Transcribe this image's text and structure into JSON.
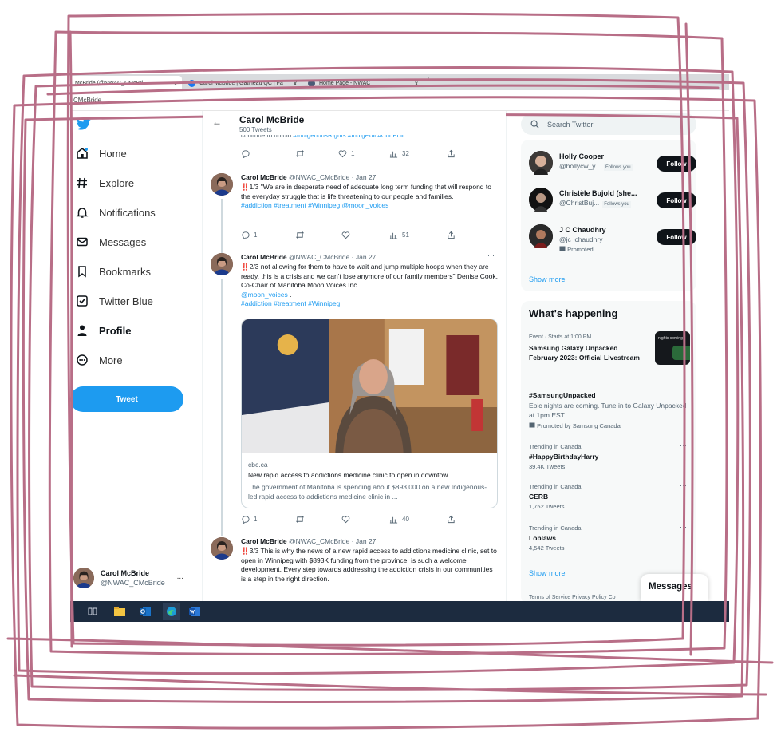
{
  "browser": {
    "tabs": [
      {
        "label": "McBride (@NWAC_CMcBri"
      },
      {
        "label": "Carol McBride | Gatineau QC | Fa"
      },
      {
        "label": "Home Page - NWAC"
      }
    ],
    "tab_close": "x",
    "new_tab": "+",
    "url": "CMcBride"
  },
  "sidebar": {
    "items": [
      {
        "label": "Home",
        "icon": "home-icon"
      },
      {
        "label": "Explore",
        "icon": "hashtag-icon"
      },
      {
        "label": "Notifications",
        "icon": "bell-icon"
      },
      {
        "label": "Messages",
        "icon": "envelope-icon"
      },
      {
        "label": "Bookmarks",
        "icon": "bookmark-icon"
      },
      {
        "label": "Twitter Blue",
        "icon": "twitter-blue-icon"
      },
      {
        "label": "Profile",
        "icon": "person-icon"
      },
      {
        "label": "More",
        "icon": "more-circle-icon"
      }
    ],
    "tweet_button": "Tweet",
    "account": {
      "name": "Carol McBride",
      "handle": "@NWAC_CMcBride",
      "more": "..."
    }
  },
  "profile_header": {
    "back": "←",
    "name": "Carol McBride",
    "tweet_count": "500 Tweets"
  },
  "partial_tweet": {
    "text": "continue to unfold ",
    "tags": "#IndigenousRights #IndigPoli #CdnPoli",
    "actions": {
      "reply": "",
      "retweet": "",
      "like": "1",
      "views": "32"
    }
  },
  "tweets": [
    {
      "name": "Carol McBride",
      "handle": "@NWAC_CMcBride · Jan 27",
      "dots": "···",
      "marker": "‼️",
      "text": "1/3 \"We are in desperate need of adequate long term funding that will respond to the everyday struggle that is life threatening to our people and families.",
      "tags": "#addiction #treatment #Winnipeg @moon_voices",
      "actions": {
        "reply": "1",
        "retweet": "",
        "like": "",
        "views": "51"
      }
    },
    {
      "name": "Carol McBride",
      "handle": "@NWAC_CMcBride · Jan 27",
      "dots": "···",
      "marker": "‼️",
      "text": "2/3 not allowing for them to have to wait and jump multiple hoops when they are ready, this is a crisis and we can't lose anymore of our family members\"  Denise Cook, Co-Chair of Manitoba Moon Voices Inc.",
      "mention": "@moon_voices",
      "mention_tail": " .",
      "tags": "#addiction #treatment #Winnipeg",
      "card": {
        "domain": "cbc.ca",
        "title": "New rapid access to addictions medicine clinic to open in downtow...",
        "description": "The government of Manitoba is spending about $893,000 on a new Indigenous-led rapid access to addictions medicine clinic in ..."
      },
      "actions": {
        "reply": "1",
        "retweet": "",
        "like": "",
        "views": "40"
      }
    },
    {
      "name": "Carol McBride",
      "handle": "@NWAC_CMcBride · Jan 27",
      "dots": "···",
      "marker": "‼️",
      "text": "3/3 This is why the news of a new rapid access to addictions medicine clinic, set to open in Winnipeg with $893K funding from the province, is such a welcome development. Every step towards addressing the addiction crisis in our communities is a step in the right direction."
    }
  ],
  "search": {
    "placeholder": "Search Twitter"
  },
  "who_to_follow": {
    "users": [
      {
        "name": "Holly Cooper",
        "handle": "@hollycw_y...",
        "follows_you": "Follows you",
        "button": "Follow"
      },
      {
        "name": "Christèle Bujold (she...",
        "handle": "@ChristBuj...",
        "follows_you": "Follows you",
        "button": "Follow"
      },
      {
        "name": "J C Chaudhry",
        "handle": "@jc_chaudhry",
        "promoted": "Promoted",
        "button": "Follow"
      }
    ],
    "show_more": "Show more"
  },
  "whats_happening": {
    "title": "What's happening",
    "event": {
      "context": "Event · Starts at 1:00 PM",
      "title": "Samsung Galaxy Unpacked February 2023: Official Livestream",
      "thumb_text": "nights coming"
    },
    "promo": {
      "title": "#SamsungUnpacked",
      "desc": "Epic nights are coming. Tune in to Galaxy Unpacked at 1pm EST.",
      "by": "Promoted by Samsung Canada"
    },
    "trends": [
      {
        "context": "Trending in Canada",
        "title": "#HappyBirthdayHarry",
        "count": "39.4K Tweets"
      },
      {
        "context": "Trending in Canada",
        "title": "CERB",
        "count": "1,752 Tweets"
      },
      {
        "context": "Trending in Canada",
        "title": "Loblaws",
        "count": "4,542 Tweets"
      }
    ],
    "show_more": "Show more",
    "dots": "···"
  },
  "messages_drawer": "Messages",
  "footer": "Terms of Service   Privacy Policy   Co",
  "colors": {
    "accent": "#1d9bf0",
    "scribble": "#b86e87",
    "taskbar": "#1c2b3f"
  }
}
